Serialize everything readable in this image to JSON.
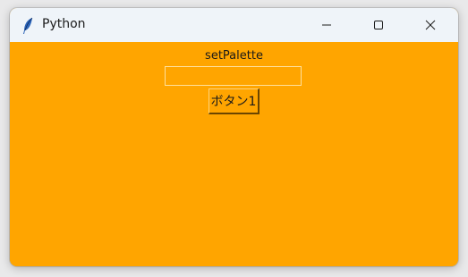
{
  "window": {
    "title": "Python",
    "background": "#ffa500",
    "titlebar_color": "#eff4f9"
  },
  "titlebar": {
    "icon": "feather-icon",
    "controls": [
      "minimize-icon",
      "maximize-icon",
      "close-icon"
    ]
  },
  "main": {
    "label": "setPalette",
    "entry_value": "",
    "button_label": "ボタン1"
  }
}
